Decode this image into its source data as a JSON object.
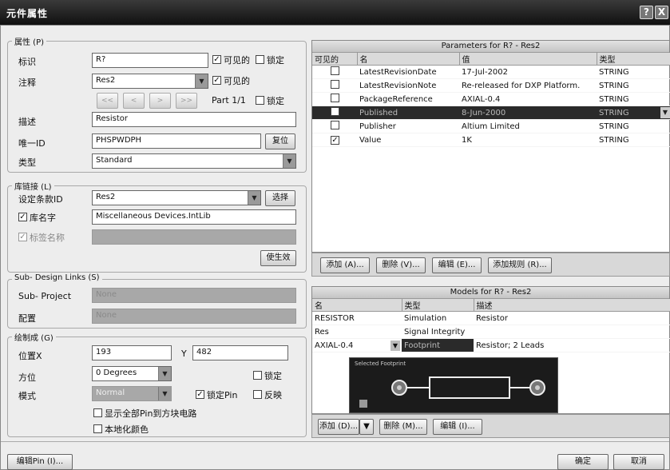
{
  "title": "元件属性",
  "titlebar": {
    "help": "?",
    "close": "X"
  },
  "props": {
    "legend": "属性 (P)",
    "designator_label": "标识",
    "designator_value": "R?",
    "visible1": "可见的",
    "lock1": "锁定",
    "comment_label": "注释",
    "comment_value": "Res2",
    "visible2": "可见的",
    "nav": [
      "<<",
      "<",
      ">",
      ">>"
    ],
    "part": "Part 1/1",
    "lock2": "锁定",
    "desc_label": "描述",
    "desc_value": "Resistor",
    "uid_label": "唯一ID",
    "uid_value": "PHSPWDPH",
    "reset": "复位",
    "type_label": "类型",
    "type_value": "Standard"
  },
  "lib": {
    "legend": "库链接 (L)",
    "item_label": "设定条款ID",
    "item_value": "Res2",
    "choose": "选择",
    "libname_label": "库名字",
    "libname_value": "Miscellaneous Devices.IntLib",
    "symbol_label": "标签名称",
    "apply": "使生效"
  },
  "subdesign": {
    "legend": "Sub- Design Links (S)",
    "project_label": "Sub- Project",
    "project_value": "None",
    "config_label": "配置",
    "config_value": "None"
  },
  "graph": {
    "legend": "绘制成 (G)",
    "posx_label": "位置X",
    "posx_value": "193",
    "y_label": "Y",
    "posy_value": "482",
    "orient_label": "方位",
    "orient_value": "0 Degrees",
    "lock": "锁定",
    "mode_label": "模式",
    "mode_value": "Normal",
    "lockpin": "锁定Pin",
    "mirror": "反映",
    "showall": "显示全部Pin到方块电路",
    "localcolor": "本地化颜色"
  },
  "params": {
    "title": "Parameters for R? - Res2",
    "cols": [
      "可见的",
      "名",
      "值",
      "类型"
    ],
    "rows": [
      {
        "name": "LatestRevisionDate",
        "value": "17-Jul-2002",
        "type": "STRING",
        "vis": ""
      },
      {
        "name": "LatestRevisionNote",
        "value": "Re-released for DXP Platform.",
        "type": "STRING",
        "vis": ""
      },
      {
        "name": "PackageReference",
        "value": "AXIAL-0.4",
        "type": "STRING",
        "vis": ""
      },
      {
        "name": "Published",
        "value": "8-Jun-2000",
        "type": "STRING",
        "vis": ""
      },
      {
        "name": "Publisher",
        "value": "Altium Limited",
        "type": "STRING",
        "vis": ""
      },
      {
        "name": "Value",
        "value": "1K",
        "type": "STRING",
        "vis": "✓"
      }
    ],
    "buttons": [
      "添加 (A)...",
      "删除 (V)...",
      "编辑 (E)...",
      "添加规则 (R)..."
    ]
  },
  "models": {
    "title": "Models for R? - Res2",
    "cols": [
      "名",
      "类型",
      "描述"
    ],
    "rows": [
      {
        "name": "RESISTOR",
        "type": "Simulation",
        "desc": "Resistor"
      },
      {
        "name": "Res",
        "type": "Signal Integrity",
        "desc": ""
      },
      {
        "name": "AXIAL-0.4",
        "type": "Footprint",
        "desc": "Resistor; 2 Leads"
      }
    ],
    "preview": "Selected Footprint",
    "buttons": [
      "添加 (D)...",
      "删除 (M)...",
      "编辑 (I)..."
    ]
  },
  "footer": {
    "editpin": "编辑Pin (I)...",
    "ok": "确定",
    "cancel": "取消"
  }
}
